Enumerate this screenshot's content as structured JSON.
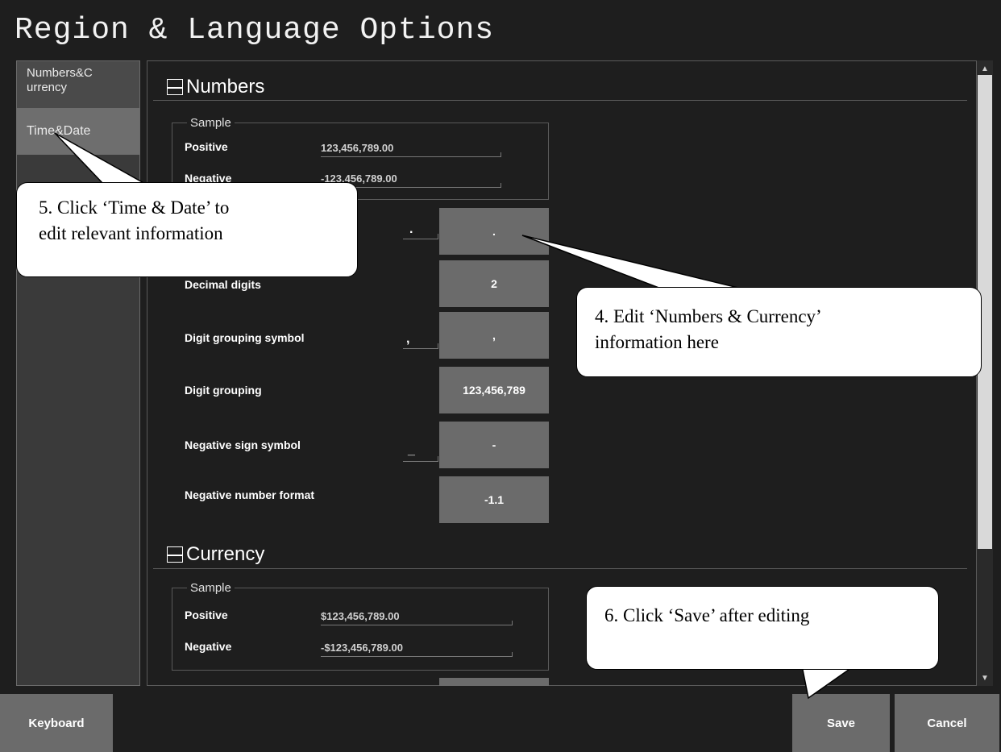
{
  "window": {
    "title": "Region & Language Options"
  },
  "sidebar": {
    "items": [
      {
        "label": "Numbers&C urrency"
      },
      {
        "label": "Time&Date"
      }
    ]
  },
  "numbers": {
    "title": "Numbers",
    "sample_legend": "Sample",
    "positive_label": "Positive",
    "positive_value": "123,456,789.00",
    "negative_label": "Negative",
    "negative_value": "-123,456,789.00",
    "decimal_symbol_input": ".",
    "decimal_symbol_box": ".",
    "decimal_digits_label": "Decimal digits",
    "decimal_digits_value": "2",
    "digit_grouping_symbol_label": "Digit grouping symbol",
    "digit_grouping_symbol_input": ",",
    "digit_grouping_symbol_box": ",",
    "digit_grouping_label": "Digit grouping",
    "digit_grouping_value": "123,456,789",
    "negative_sign_label": "Negative sign symbol",
    "negative_sign_input": "_",
    "negative_sign_box": "-",
    "negative_format_label": "Negative number format",
    "negative_format_value": "-1.1"
  },
  "currency": {
    "title": "Currency",
    "sample_legend": "Sample",
    "positive_label": "Positive",
    "positive_value": "$123,456,789.00",
    "negative_label": "Negative",
    "negative_value": "-$123,456,789.00"
  },
  "footer": {
    "keyboard": "Keyboard",
    "save": "Save",
    "cancel": "Cancel"
  },
  "callouts": {
    "c5_line1": "5. Click ‘Time & Date’ to",
    "c5_line2": "edit relevant information",
    "c4_line1": "4. Edit ‘Numbers & Currency’",
    "c4_line2": "information here",
    "c6": "6. Click ‘Save’ after editing"
  },
  "icons": {
    "collapse": "minus-box-icon",
    "scroll_up": "chevron-up-icon",
    "scroll_down": "chevron-down-icon"
  }
}
